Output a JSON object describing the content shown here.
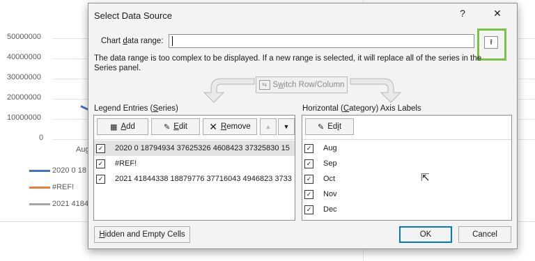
{
  "background_chart": {
    "y_ticks": [
      "50000000",
      "40000000",
      "30000000",
      "20000000",
      "10000000",
      "0"
    ],
    "x_label": "Aug",
    "legend": [
      {
        "label": "2020 0 18",
        "color": "#4472c4"
      },
      {
        "label": "#REF!",
        "color": "#ed7d31"
      },
      {
        "label": "2021 4184",
        "color": "#a5a5a5"
      }
    ]
  },
  "dialog": {
    "title": "Select Data Source",
    "help": "?",
    "close": "✕",
    "range_label_pre": "Chart ",
    "range_label_key": "d",
    "range_label_post": "ata range:",
    "range_value": "",
    "collapse_glyph": "⭱",
    "message": "The data range is too complex to be displayed. If a new range is selected, it will replace all of the series in the Series panel.",
    "switch_pre": "S",
    "switch_key": "w",
    "switch_post": "itch Row/Column",
    "legend_panel": {
      "title_pre": "Legend Entries (",
      "title_key": "S",
      "title_post": "eries)",
      "add": {
        "key": "A",
        "rest": "dd"
      },
      "edit": {
        "key": "E",
        "rest": "dit"
      },
      "remove": {
        "key": "R",
        "rest": "emove"
      },
      "up": "▲",
      "down": "▼",
      "series": [
        "2020 0 18794934 37625326 4608423 37325830 15",
        "#REF!",
        "2021 41844338 18879776 37716043 4946823 3733"
      ]
    },
    "axis_panel": {
      "title_pre": "Horizontal (",
      "title_key": "C",
      "title_post": "ategory) Axis Labels",
      "edit_pre": "Ed",
      "edit_key": "i",
      "edit_post": "t",
      "labels": [
        "Aug",
        "Sep",
        "Oct",
        "Nov",
        "Dec"
      ]
    },
    "hidden_cells": {
      "key": "H",
      "rest": "idden and Empty Cells"
    },
    "ok": "OK",
    "cancel": "Cancel",
    "check_glyph": "✓"
  },
  "colors": {
    "highlight_border": "#7dc142",
    "ok_border": "#0078d7"
  }
}
